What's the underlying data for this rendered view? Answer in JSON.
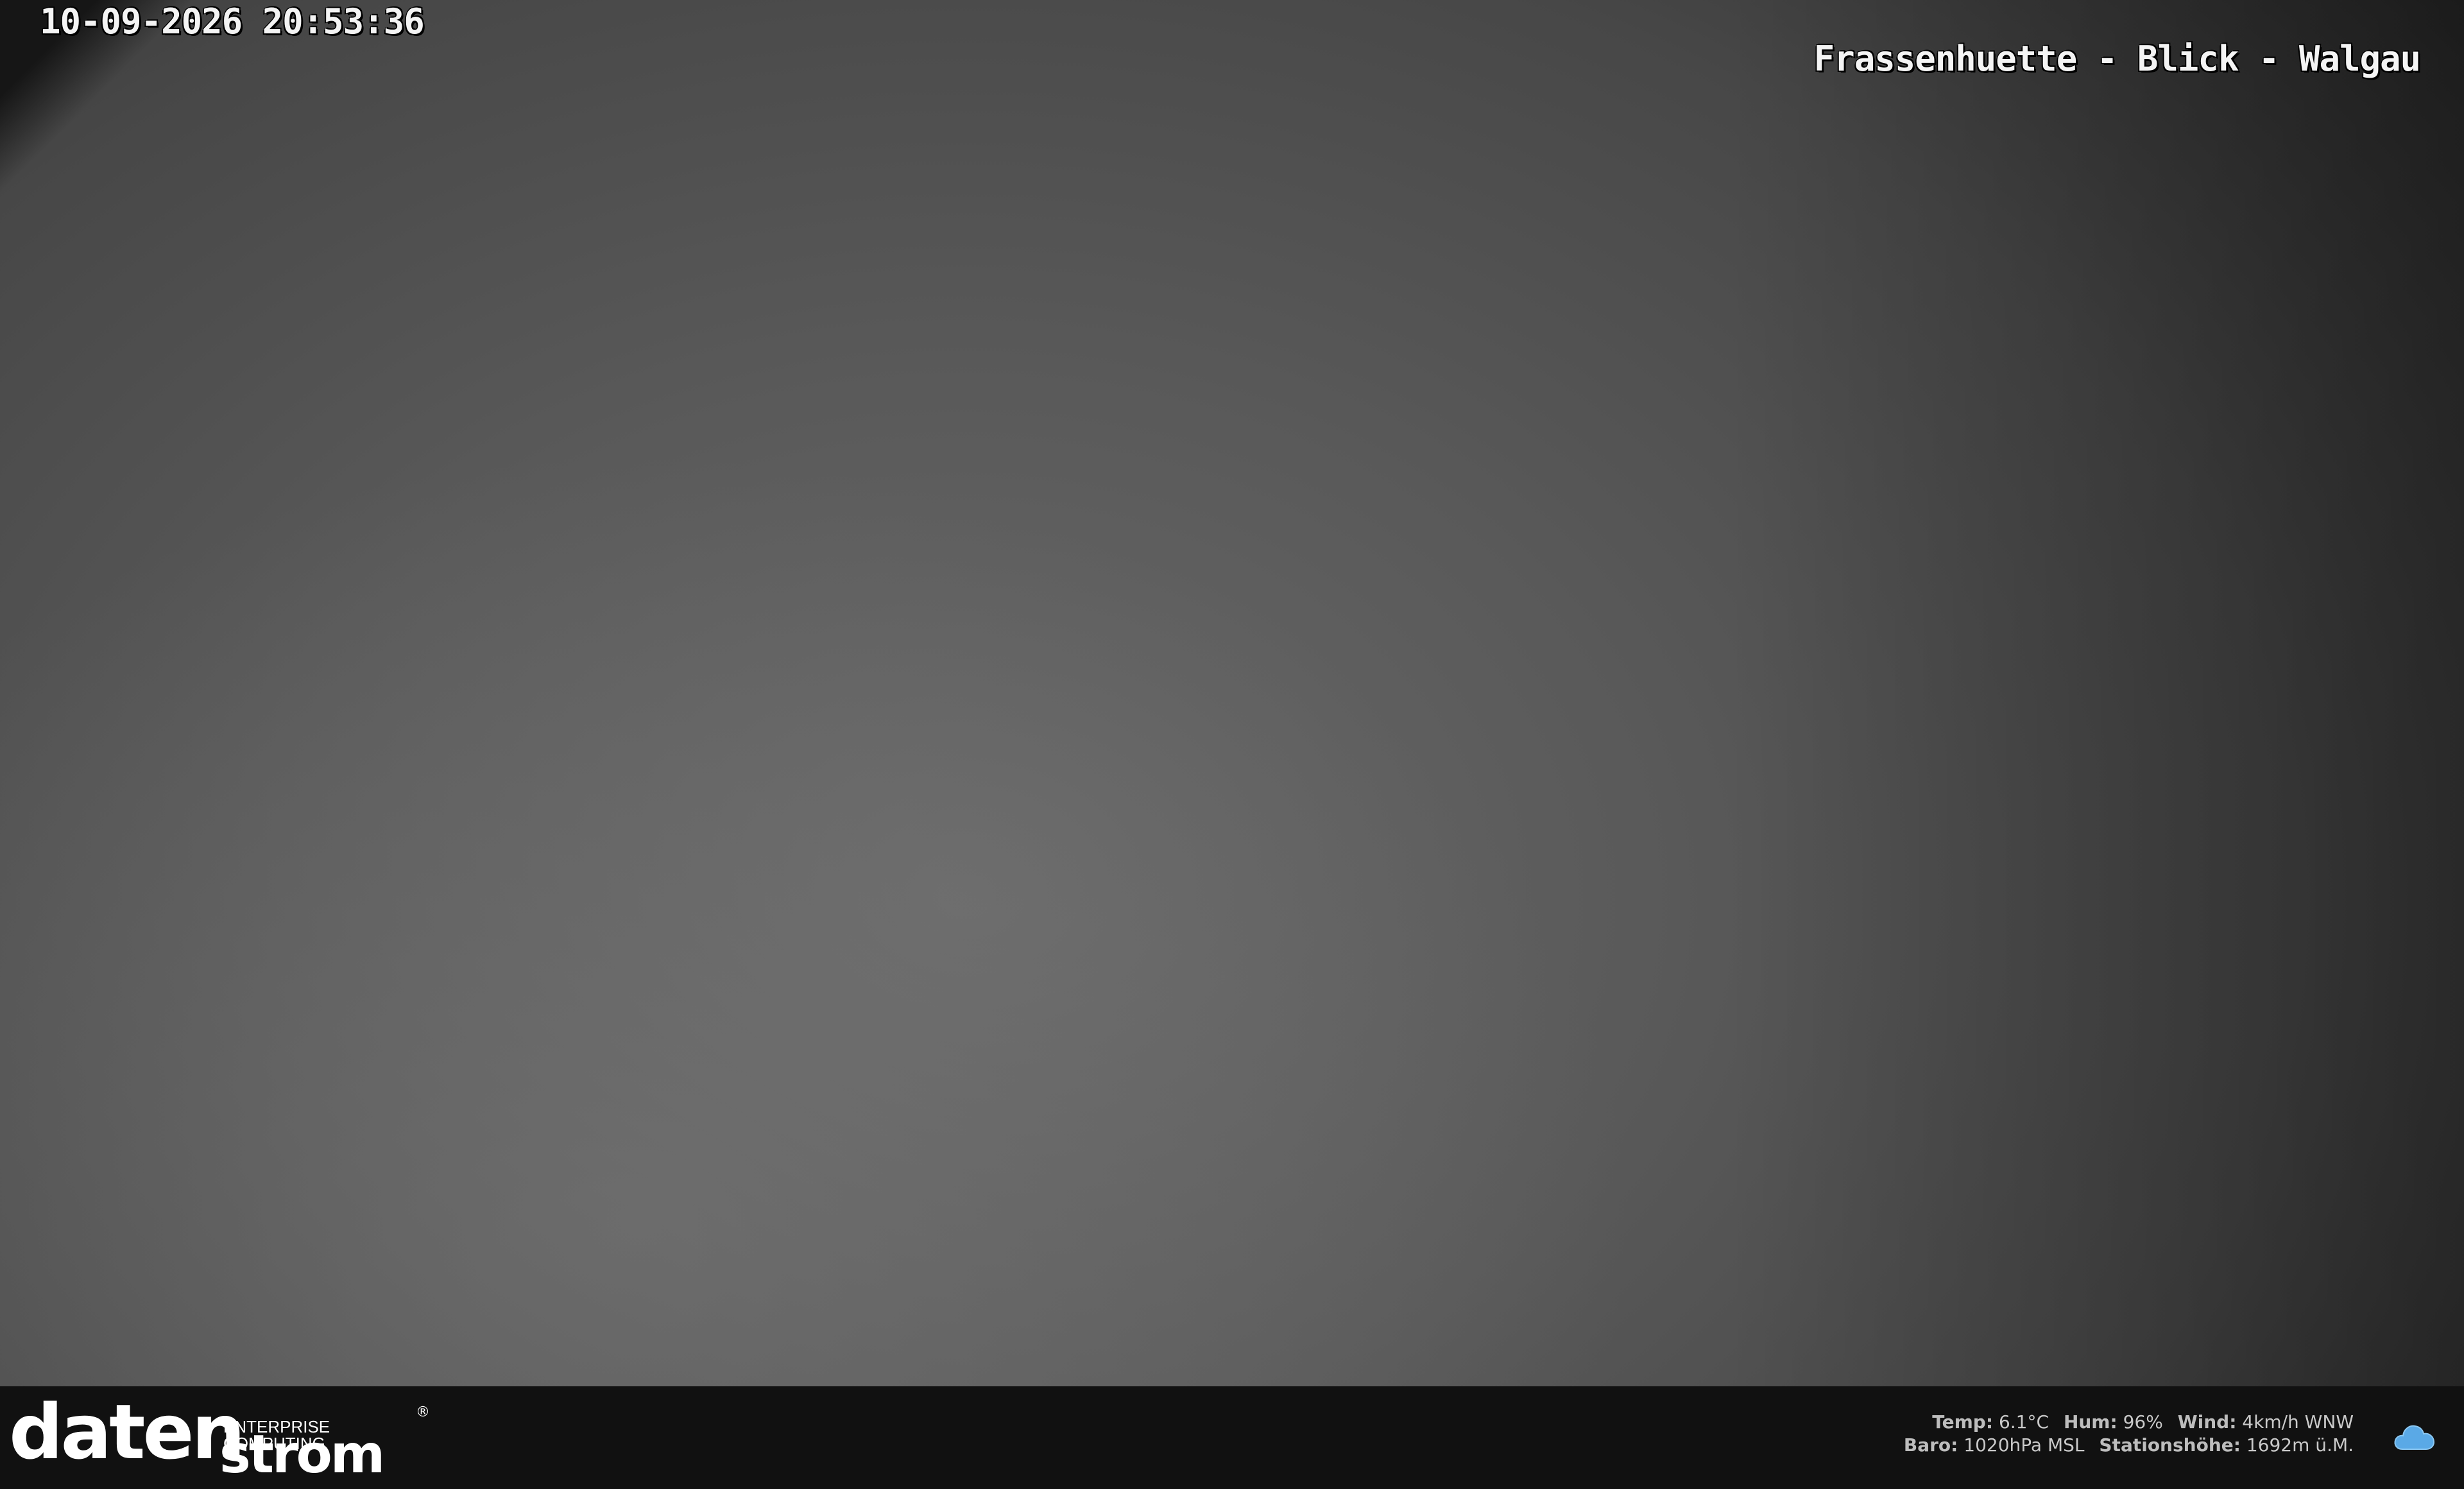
{
  "osd": {
    "timestamp": "10-09-2026 20:53:36",
    "camera_title": "Frassenhuette - Blick - Walgau"
  },
  "footer": {
    "logo": {
      "main": "daten",
      "sub_word": "strom",
      "tagline": "ENTERPRISE COMPUTING",
      "registered": "®"
    },
    "weather": {
      "temp_label": "Temp:",
      "temp_value": "6.1°C",
      "hum_label": "Hum:",
      "hum_value": "96%",
      "wind_label": "Wind:",
      "wind_value": "4km/h WNW",
      "baro_label": "Baro:",
      "baro_value": "1020hPa MSL",
      "station_label": "Stationshöhe:",
      "station_value": "1692m ü.M.",
      "icon": "cloud-icon"
    }
  },
  "colors": {
    "footer_background": "#111111",
    "osd_text": "#f4f4f4",
    "cloud_icon": "#5aa9e6"
  }
}
